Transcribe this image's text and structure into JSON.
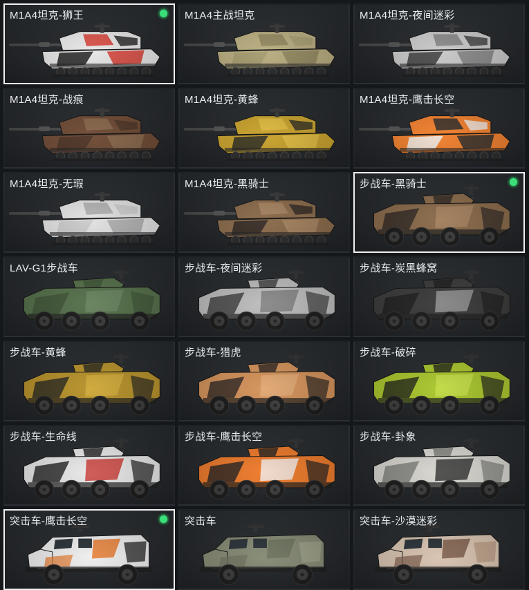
{
  "items": [
    {
      "title": "M1A4坦克-狮王",
      "type": "tank",
      "colors": [
        "#e8e8e8",
        "#1c1c1c",
        "#d63a2f"
      ],
      "equipped": true
    },
    {
      "title": "M1A4主战坦克",
      "type": "tank",
      "colors": [
        "#b9ad80",
        "#a39a6e",
        "#8d845d"
      ],
      "equipped": false
    },
    {
      "title": "M1A4坦克-夜间迷彩",
      "type": "tank",
      "colors": [
        "#c9c9c9",
        "#3a3a3a",
        "#808080"
      ],
      "equipped": false
    },
    {
      "title": "M1A4坦克-战痕",
      "type": "tank",
      "colors": [
        "#6e4a34",
        "#4a3124",
        "#8b6a4e"
      ],
      "equipped": false
    },
    {
      "title": "M1A4坦克-黄蜂",
      "type": "tank",
      "colors": [
        "#c9a22c",
        "#2a2a22",
        "#e0bd43"
      ],
      "equipped": false
    },
    {
      "title": "M1A4坦克-鹰击长空",
      "type": "tank",
      "colors": [
        "#f07f2d",
        "#eeeeee",
        "#2c2c2c"
      ],
      "equipped": false
    },
    {
      "title": "M1A4坦克-无瑕",
      "type": "tank",
      "colors": [
        "#e2e2e2",
        "#c8c8c8",
        "#a9a9a9"
      ],
      "equipped": false
    },
    {
      "title": "M1A4坦克-黑骑士",
      "type": "tank",
      "colors": [
        "#8a6a4a",
        "#2c2521",
        "#a78562"
      ],
      "equipped": false
    },
    {
      "title": "步战车-黑骑士",
      "type": "ifv",
      "colors": [
        "#8a6a4a",
        "#2c2521",
        "#a78562"
      ],
      "equipped": true
    },
    {
      "title": "LAV-G1步战车",
      "type": "ifv",
      "colors": [
        "#55704a",
        "#3d5235",
        "#6a8660"
      ],
      "equipped": false
    },
    {
      "title": "步战车-夜间迷彩",
      "type": "ifv",
      "colors": [
        "#bdbdbd",
        "#3a3a3a",
        "#7c7c7c"
      ],
      "equipped": false
    },
    {
      "title": "步战车-炭黑蜂窝",
      "type": "ifv",
      "colors": [
        "#3a3a3a",
        "#1d1d1d",
        "#9a9a9a"
      ],
      "equipped": false
    },
    {
      "title": "步战车-黄蜂",
      "type": "ifv",
      "colors": [
        "#b8922a",
        "#26261f",
        "#d4ae3c"
      ],
      "equipped": false
    },
    {
      "title": "步战车-猎虎",
      "type": "ifv",
      "colors": [
        "#d5935a",
        "#2a2420",
        "#e3ad78"
      ],
      "equipped": false
    },
    {
      "title": "步战车-破碎",
      "type": "ifv",
      "colors": [
        "#a9c72c",
        "#1f2218",
        "#c5df4a"
      ],
      "equipped": false
    },
    {
      "title": "步战车-生命线",
      "type": "ifv",
      "colors": [
        "#e8e8e8",
        "#1b1b1b",
        "#c8312a"
      ],
      "equipped": false
    },
    {
      "title": "步战车-鹰击长空",
      "type": "ifv",
      "colors": [
        "#ee7a2a",
        "#202020",
        "#f2f2f2"
      ],
      "equipped": false
    },
    {
      "title": "步战车-卦象",
      "type": "ifv",
      "colors": [
        "#d8d6d0",
        "#7a7a76",
        "#2a2a2a"
      ],
      "equipped": false
    },
    {
      "title": "突击车-鹰击长空",
      "type": "mrap",
      "colors": [
        "#eeeeee",
        "#e6782b",
        "#2a2a2a"
      ],
      "equipped": true
    },
    {
      "title": "突击车",
      "type": "mrap",
      "colors": [
        "#858a74",
        "#6c715e",
        "#9ca189"
      ],
      "equipped": false
    },
    {
      "title": "突击车-沙漠迷彩",
      "type": "mrap",
      "colors": [
        "#d8c3b0",
        "#7a5a48",
        "#b89a82"
      ],
      "equipped": false
    }
  ]
}
